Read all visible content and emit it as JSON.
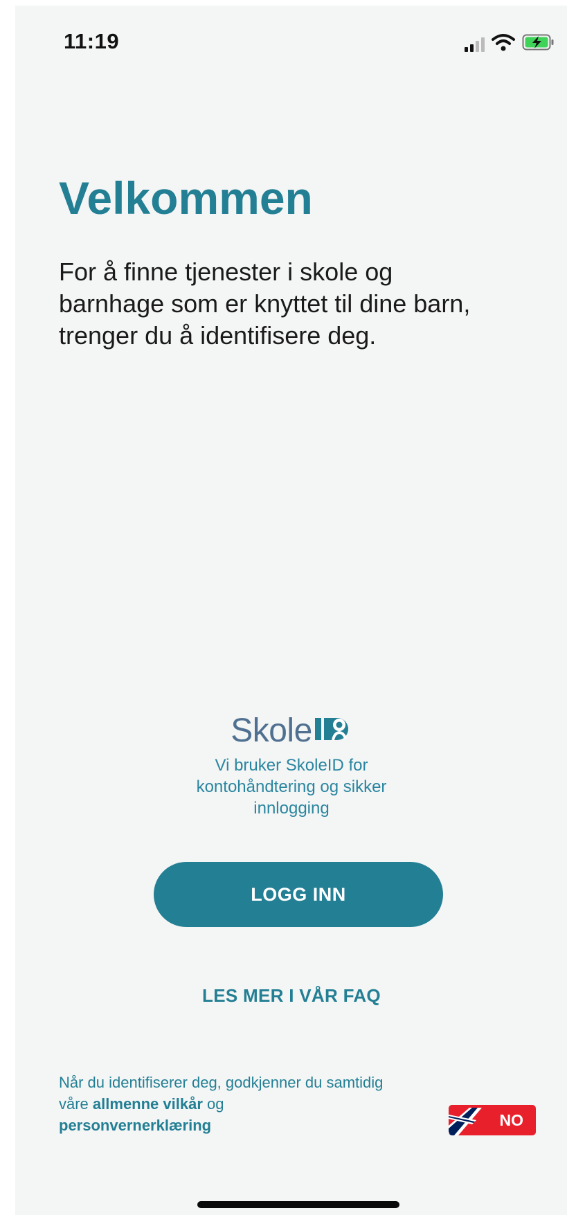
{
  "status_bar": {
    "time": "11:19",
    "icons": [
      "cellular-signal-icon",
      "wifi-icon",
      "battery-charging-icon"
    ]
  },
  "welcome": {
    "title": "Velkommen",
    "intro": "For å finne tjenester i skole og\nbarnhage som er knyttet til dine barn,\ntrenger du å identifisere deg."
  },
  "skoleid": {
    "logo_text": "Skole",
    "description": "Vi bruker SkoleID for\nkontohåndtering og sikker\ninnlogging"
  },
  "actions": {
    "login_label": "LOGG INN",
    "faq_label": "LES MER I VÅR FAQ"
  },
  "consent": {
    "prefix": "Når du identifiserer deg, godkjenner du samtidig våre ",
    "terms_link": "allmenne vilkår",
    "joiner": " og",
    "privacy_link": "personvernerklæring"
  },
  "language": {
    "code": "NO",
    "flag": "norway-flag-icon"
  },
  "colors": {
    "brand_teal": "#237f94",
    "light_teal": "#2a86a0",
    "background": "#f4f5f5",
    "logo_slate": "#4f7090",
    "flag_red": "#e8202c",
    "flag_blue": "#00205b"
  }
}
